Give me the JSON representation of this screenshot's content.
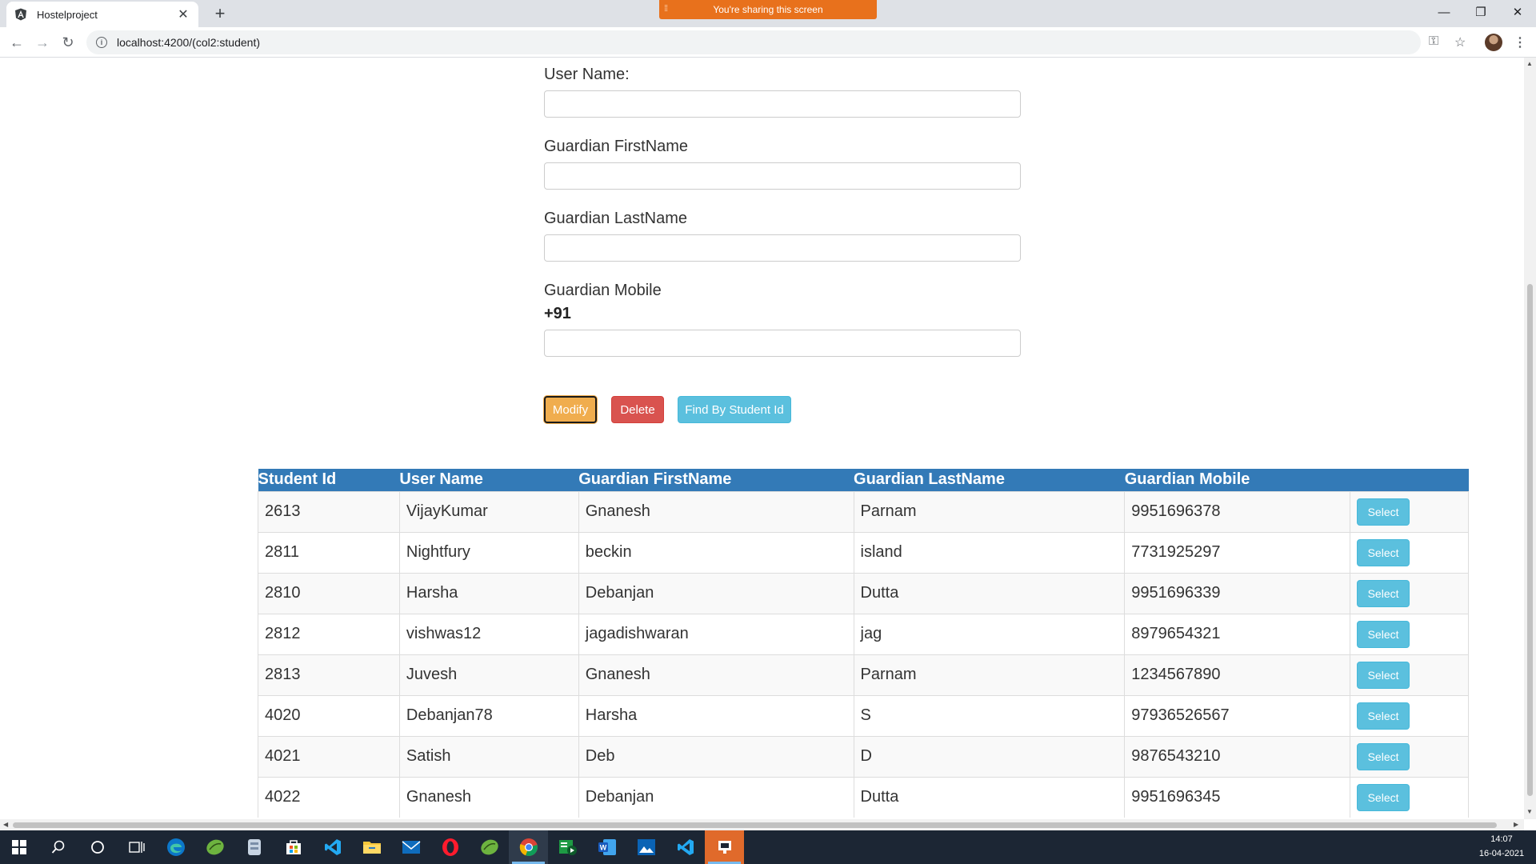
{
  "browser": {
    "tab_title": "Hostelproject",
    "url": "localhost:4200/(col2:student)",
    "share_banner": "You're sharing this screen"
  },
  "form": {
    "username_label": "User Name:",
    "username_value": "",
    "guardian_first_label": "Guardian FirstName",
    "guardian_first_value": "",
    "guardian_last_label": "Guardian LastName",
    "guardian_last_value": "",
    "guardian_mobile_label": "Guardian Mobile",
    "mobile_prefix": "+91",
    "guardian_mobile_value": ""
  },
  "actions": {
    "modify": "Modify",
    "delete": "Delete",
    "find": "Find By Student Id"
  },
  "table": {
    "headers": [
      "Student Id",
      "User Name",
      "Guardian FirstName",
      "Guardian LastName",
      "Guardian Mobile",
      ""
    ],
    "select_label": "Select",
    "rows": [
      [
        "2613",
        "VijayKumar",
        "Gnanesh",
        "Parnam",
        "9951696378"
      ],
      [
        "2811",
        "Nightfury",
        "beckin",
        "island",
        "7731925297"
      ],
      [
        "2810",
        "Harsha",
        "Debanjan",
        "Dutta",
        "9951696339"
      ],
      [
        "2812",
        "vishwas12",
        "jagadishwaran",
        "jag",
        "8979654321"
      ],
      [
        "2813",
        "Juvesh",
        "Gnanesh",
        "Parnam",
        "1234567890"
      ],
      [
        "4020",
        "Debanjan78",
        "Harsha",
        "S",
        "97936526567"
      ],
      [
        "4021",
        "Satish",
        "Deb",
        "D",
        "9876543210"
      ],
      [
        "4022",
        "Gnanesh",
        "Debanjan",
        "Dutta",
        "9951696345"
      ]
    ]
  },
  "taskbar": {
    "time": "14:07",
    "date": "16-04-2021"
  },
  "colors": {
    "table_header": "#337ab7",
    "modify": "#f0ad4e",
    "delete": "#d9534f",
    "info": "#5bc0de"
  }
}
